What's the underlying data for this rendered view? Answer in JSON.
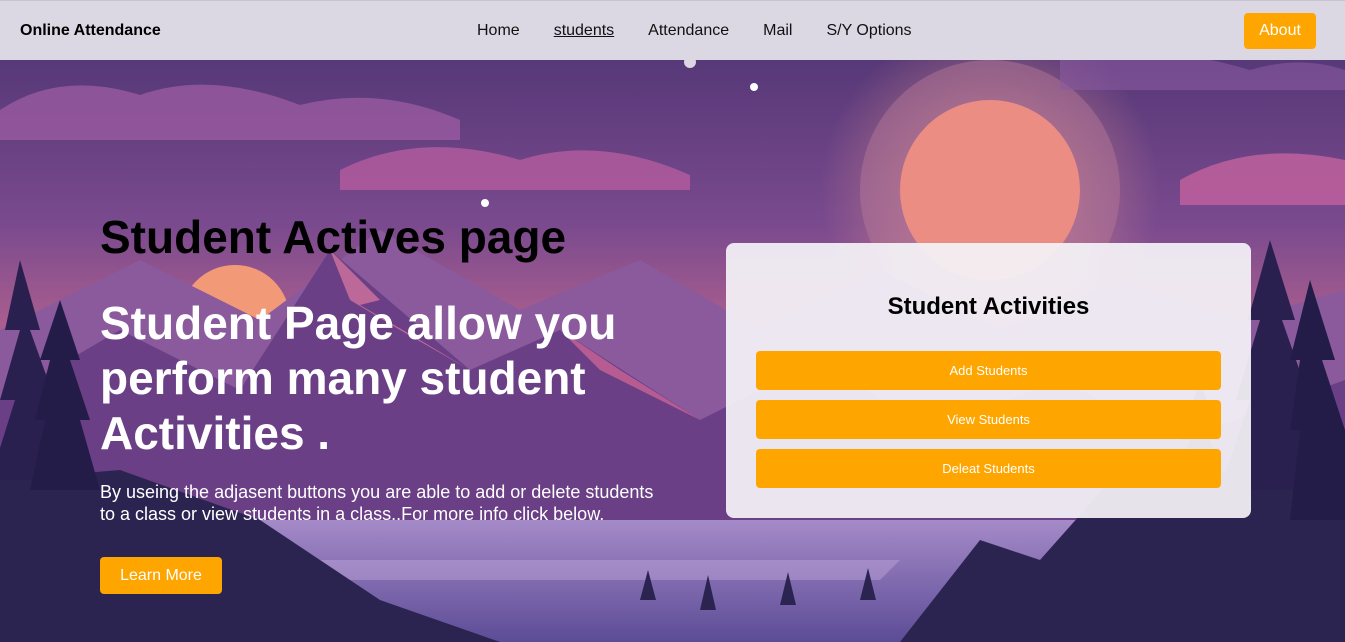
{
  "navbar": {
    "brand": "Online Attendance",
    "links": [
      {
        "label": "Home"
      },
      {
        "label": "students"
      },
      {
        "label": "Attendance"
      },
      {
        "label": "Mail"
      },
      {
        "label": "S/Y Options"
      }
    ],
    "about_label": "About"
  },
  "hero": {
    "title": "Student Actives page",
    "subtitle": "Student Page allow you perform many student Activities .",
    "description": "By useing the adjasent buttons you are able to add or delete students to a class or view students in a class..For more info click below.",
    "learn_more_label": "Learn More"
  },
  "card": {
    "title": "Student Activities",
    "buttons": [
      {
        "label": "Add Students"
      },
      {
        "label": "View Students"
      },
      {
        "label": "Deleat Students"
      }
    ]
  },
  "colors": {
    "accent": "#ffa500",
    "navbar_bg": "#dcd8e3",
    "card_bg": "#f4f2f7"
  },
  "icons": {
    "background": "mountain-lake-sunset-illustration"
  }
}
